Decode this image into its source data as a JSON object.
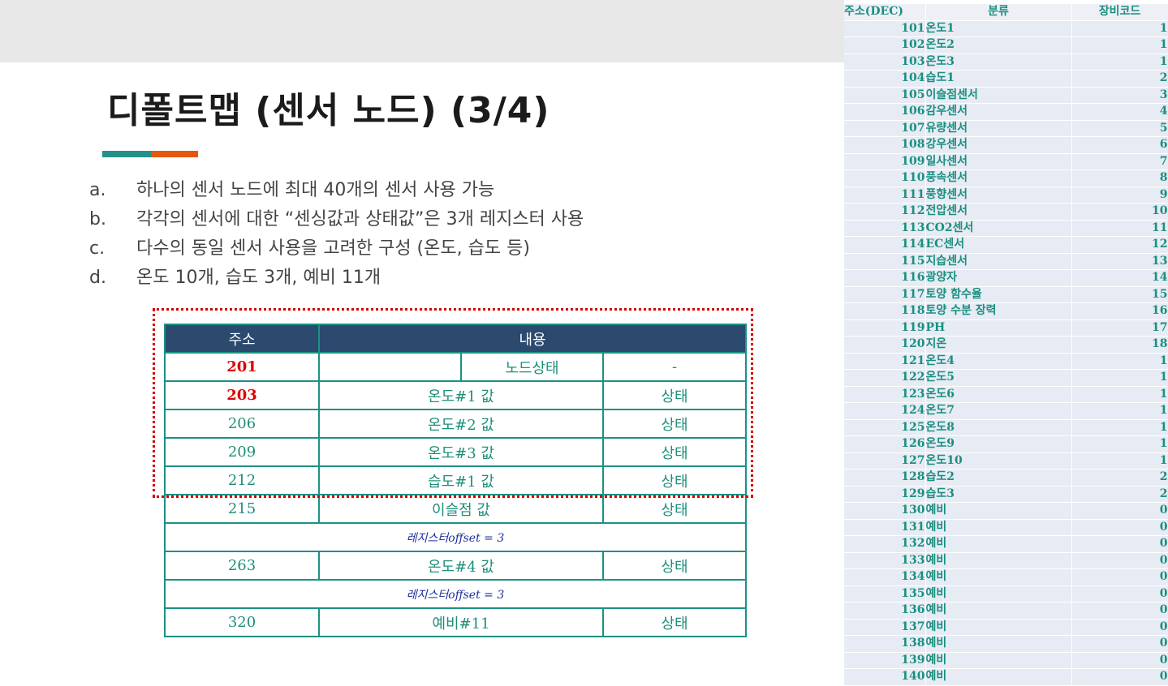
{
  "slide": {
    "title": "디폴트맵 (센서 노드) (3/4)",
    "bullets": [
      {
        "marker": "a.",
        "text": "하나의 센서 노드에 최대 40개의 센서 사용 가능"
      },
      {
        "marker": "b.",
        "text": "각각의 센서에 대한 “센싱값과 상태값”은 3개 레지스터 사용"
      },
      {
        "marker": "c.",
        "text": "다수의 동일 센서 사용을 고려한 구성 (온도, 습도 등)"
      },
      {
        "marker": "d.",
        "text": "온도 10개, 습도 3개, 예비 11개"
      }
    ]
  },
  "register_table": {
    "header": {
      "address": "주소",
      "content": "내용"
    },
    "node_row": {
      "address": "201",
      "blank": "",
      "value": "노드상태",
      "status": "-"
    },
    "rows": [
      {
        "address": "203",
        "value": "온도#1 값",
        "status": "상태"
      },
      {
        "address": "206",
        "value": "온도#2 값",
        "status": "상태"
      },
      {
        "address": "209",
        "value": "온도#3 값",
        "status": "상태"
      },
      {
        "address": "212",
        "value": "습도#1 값",
        "status": "상태"
      },
      {
        "address": "215",
        "value": "이슬점 값",
        "status": "상태"
      }
    ],
    "offset_note": "레지스터offset = 3",
    "row_263": {
      "address": "263",
      "value": "온도#4 값",
      "status": "상태"
    },
    "row_320": {
      "address": "320",
      "value": "예비#11",
      "status": "상태"
    }
  },
  "code_table": {
    "headers": [
      "주소(DEC)",
      "분류",
      "장비코드"
    ],
    "rows": [
      [
        "101",
        "온도1",
        "1"
      ],
      [
        "102",
        "온도2",
        "1"
      ],
      [
        "103",
        "온도3",
        "1"
      ],
      [
        "104",
        "습도1",
        "2"
      ],
      [
        "105",
        "이슬점센서",
        "3"
      ],
      [
        "106",
        "감우센서",
        "4"
      ],
      [
        "107",
        "유량센서",
        "5"
      ],
      [
        "108",
        "강우센서",
        "6"
      ],
      [
        "109",
        "일사센서",
        "7"
      ],
      [
        "110",
        "풍속센서",
        "8"
      ],
      [
        "111",
        "풍향센서",
        "9"
      ],
      [
        "112",
        "전압센서",
        "10"
      ],
      [
        "113",
        "CO2센서",
        "11"
      ],
      [
        "114",
        "EC센서",
        "12"
      ],
      [
        "115",
        "지습센서",
        "13"
      ],
      [
        "116",
        "광양자",
        "14"
      ],
      [
        "117",
        "토양 함수율",
        "15"
      ],
      [
        "118",
        "토양 수분 장력",
        "16"
      ],
      [
        "119",
        "PH",
        "17"
      ],
      [
        "120",
        "지온",
        "18"
      ],
      [
        "121",
        "온도4",
        "1"
      ],
      [
        "122",
        "온도5",
        "1"
      ],
      [
        "123",
        "온도6",
        "1"
      ],
      [
        "124",
        "온도7",
        "1"
      ],
      [
        "125",
        "온도8",
        "1"
      ],
      [
        "126",
        "온도9",
        "1"
      ],
      [
        "127",
        "온도10",
        "1"
      ],
      [
        "128",
        "습도2",
        "2"
      ],
      [
        "129",
        "습도3",
        "2"
      ],
      [
        "130",
        "예비",
        "0"
      ],
      [
        "131",
        "예비",
        "0"
      ],
      [
        "132",
        "예비",
        "0"
      ],
      [
        "133",
        "예비",
        "0"
      ],
      [
        "134",
        "예비",
        "0"
      ],
      [
        "135",
        "예비",
        "0"
      ],
      [
        "136",
        "예비",
        "0"
      ],
      [
        "137",
        "예비",
        "0"
      ],
      [
        "138",
        "예비",
        "0"
      ],
      [
        "139",
        "예비",
        "0"
      ],
      [
        "140",
        "예비",
        "0"
      ]
    ]
  }
}
